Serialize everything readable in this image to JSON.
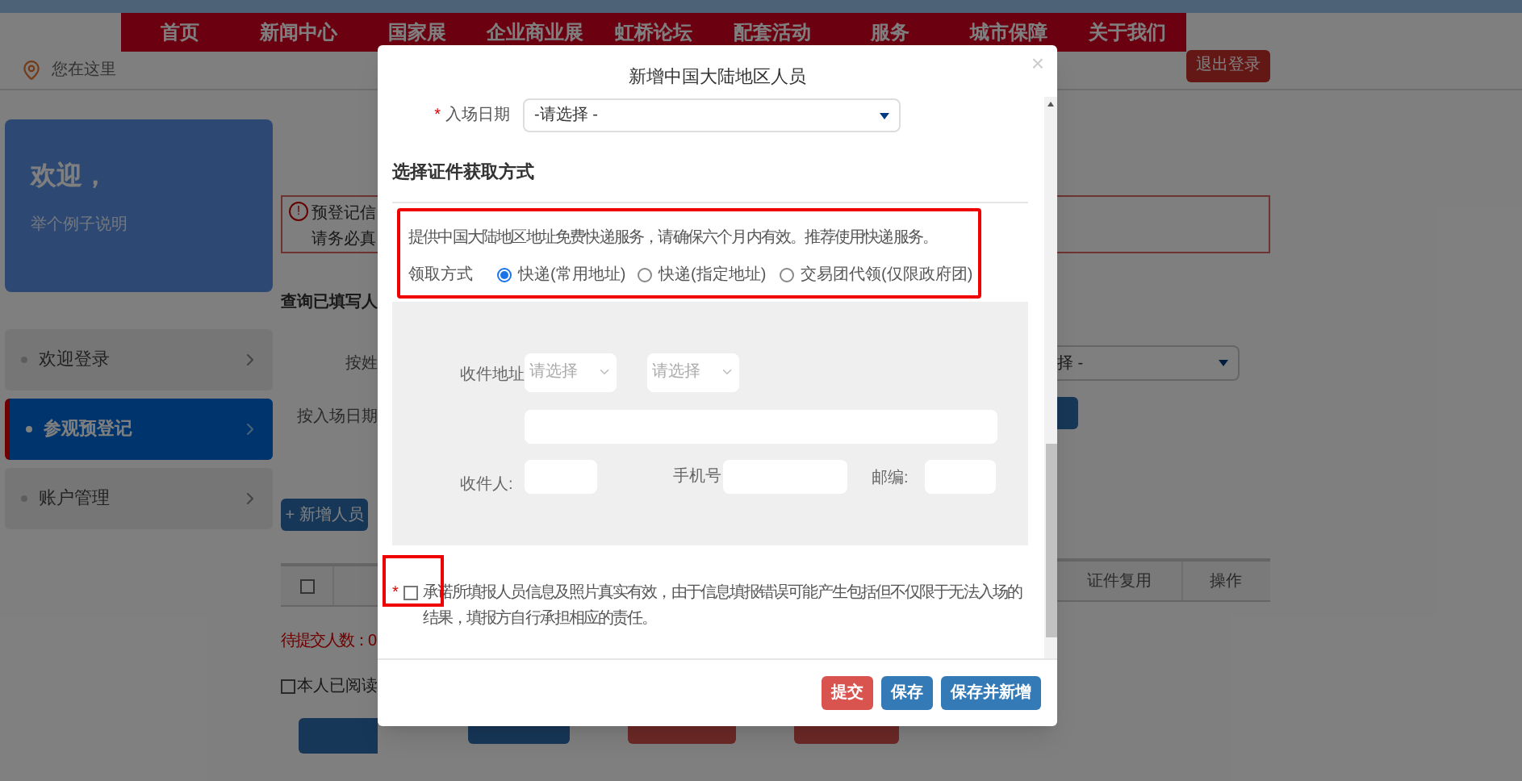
{
  "nav": {
    "items": [
      "首页",
      "新闻中心",
      "国家展",
      "企业商业展",
      "虹桥论坛",
      "配套活动",
      "服务",
      "城市保障",
      "关于我们"
    ]
  },
  "breadcrumb": {
    "label": "您在这里"
  },
  "logout_button": "退出登录",
  "welcome": {
    "title": "欢迎，",
    "subtitle": "举个例子说明"
  },
  "sidebar": {
    "items": [
      {
        "label": "欢迎登录",
        "selected": false
      },
      {
        "label": "参观预登记",
        "selected": true
      },
      {
        "label": "账户管理",
        "selected": false
      }
    ]
  },
  "background_left": {
    "header_checked": false,
    "read_checked": false,
    "warning_mark": "!",
    "notice_lines": [
      "预登记信",
      "请务必真"
    ],
    "query_title": "查询已填写人",
    "filters": [
      "按姓",
      "按入场日期"
    ],
    "add_button": "+ 新增人员",
    "pending_count": "待提交人数：0",
    "read_confirm": "本人已阅读"
  },
  "background_right": {
    "select_value": "择 -",
    "table_headers": [
      "证件复用",
      "操作"
    ]
  },
  "modal": {
    "title": "新增中国大陆地区人员",
    "close": "×",
    "required_mark": "*",
    "entry_date": {
      "label": "入场日期",
      "value": "-请选择 -"
    },
    "section_title": "选择证件获取方式",
    "info_text": "提供中国大陆地区地址免费快递服务，请确保六个月内有效。推荐使用快递服务。",
    "pickup_label": "领取方式",
    "pickup_options": [
      {
        "label": "快递(常用地址)",
        "selected": true
      },
      {
        "label": "快递(指定地址)",
        "selected": false
      },
      {
        "label": "交易团代领(仅限政府团)",
        "selected": false
      }
    ],
    "address_label": "收件地址",
    "address_selects": [
      "请选择",
      "请选择"
    ],
    "recipient_label": "收件人:",
    "phone_label": "手机号",
    "postcode_label": "邮编:",
    "agreement": {
      "checked": false,
      "text": "承诺所填报人员信息及照片真实有效，由于信息填报错误可能产生包括但不仅限于无法入场的结果，填报方自行承担相应的责任。"
    },
    "buttons": [
      {
        "label": "提交",
        "kind": "danger"
      },
      {
        "label": "保存",
        "kind": "primary"
      },
      {
        "label": "保存并新增",
        "kind": "primary"
      }
    ]
  }
}
